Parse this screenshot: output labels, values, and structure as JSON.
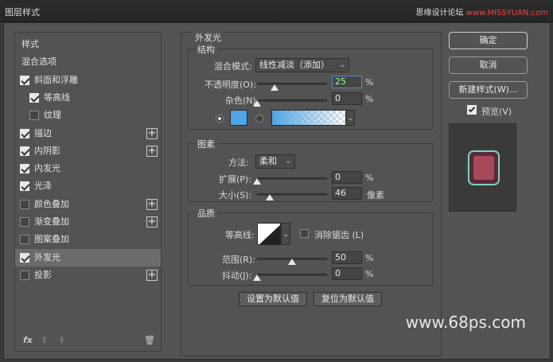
{
  "window": {
    "title": "图层样式",
    "watermark_top_1": "思缘设计论坛",
    "watermark_top_2": "www.MISSYUAN.com",
    "watermark_bottom": "www.68ps.com"
  },
  "sidebar": {
    "items": [
      {
        "label": "样式",
        "checkbox": false,
        "checked": false,
        "plus": false
      },
      {
        "label": "混合选项",
        "checkbox": false,
        "checked": false,
        "plus": false
      },
      {
        "label": "斜面和浮雕",
        "checkbox": true,
        "checked": true,
        "plus": false
      },
      {
        "label": "等高线",
        "checkbox": true,
        "checked": true,
        "plus": false,
        "indent": true
      },
      {
        "label": "纹理",
        "checkbox": true,
        "checked": false,
        "plus": false,
        "indent": true
      },
      {
        "label": "描边",
        "checkbox": true,
        "checked": true,
        "plus": true
      },
      {
        "label": "内阴影",
        "checkbox": true,
        "checked": true,
        "plus": true
      },
      {
        "label": "内发光",
        "checkbox": true,
        "checked": true,
        "plus": false
      },
      {
        "label": "光泽",
        "checkbox": true,
        "checked": true,
        "plus": false
      },
      {
        "label": "颜色叠加",
        "checkbox": true,
        "checked": false,
        "plus": true
      },
      {
        "label": "渐变叠加",
        "checkbox": true,
        "checked": false,
        "plus": true
      },
      {
        "label": "图案叠加",
        "checkbox": true,
        "checked": false,
        "plus": false
      },
      {
        "label": "外发光",
        "checkbox": true,
        "checked": true,
        "plus": false,
        "selected": true
      },
      {
        "label": "投影",
        "checkbox": true,
        "checked": false,
        "plus": true
      }
    ],
    "footer": {
      "fx": "fx",
      "up": "⬆",
      "down": "⬇",
      "trash": "🗑"
    }
  },
  "outer_glow": {
    "title": "外发光",
    "structure": {
      "title": "结构",
      "blend_mode_label": "混合模式:",
      "blend_mode_value": "线性减淡（添加）",
      "opacity_label": "不透明度(O):",
      "opacity_value": "25",
      "opacity_fraction": 0.25,
      "noise_label": "杂色(N):",
      "noise_value": "0",
      "noise_fraction": 0,
      "percent": "%",
      "solid_color": "#4ea6e4",
      "gradient_from": "#4ea6e4"
    },
    "elements": {
      "title": "图素",
      "method_label": "方法:",
      "method_value": "柔和",
      "spread_label": "扩展(P):",
      "spread_value": "0",
      "spread_fraction": 0,
      "size_label": "大小(S):",
      "size_value": "46",
      "size_fraction": 0.18,
      "size_unit": "像素",
      "percent": "%"
    },
    "quality": {
      "title": "品质",
      "contour_label": "等高线:",
      "antialias_label": "消除锯齿 (L)",
      "range_label": "范围(R):",
      "range_value": "50",
      "range_fraction": 0.5,
      "jitter_label": "抖动(J):",
      "jitter_value": "0",
      "jitter_fraction": 0,
      "percent": "%"
    },
    "make_default": "设置为默认值",
    "reset_default": "复位为默认值"
  },
  "actions": {
    "ok": "确定",
    "cancel": "取消",
    "new_style": "新建样式(W)...",
    "preview_label": "预览(V)",
    "preview_checked": true
  }
}
